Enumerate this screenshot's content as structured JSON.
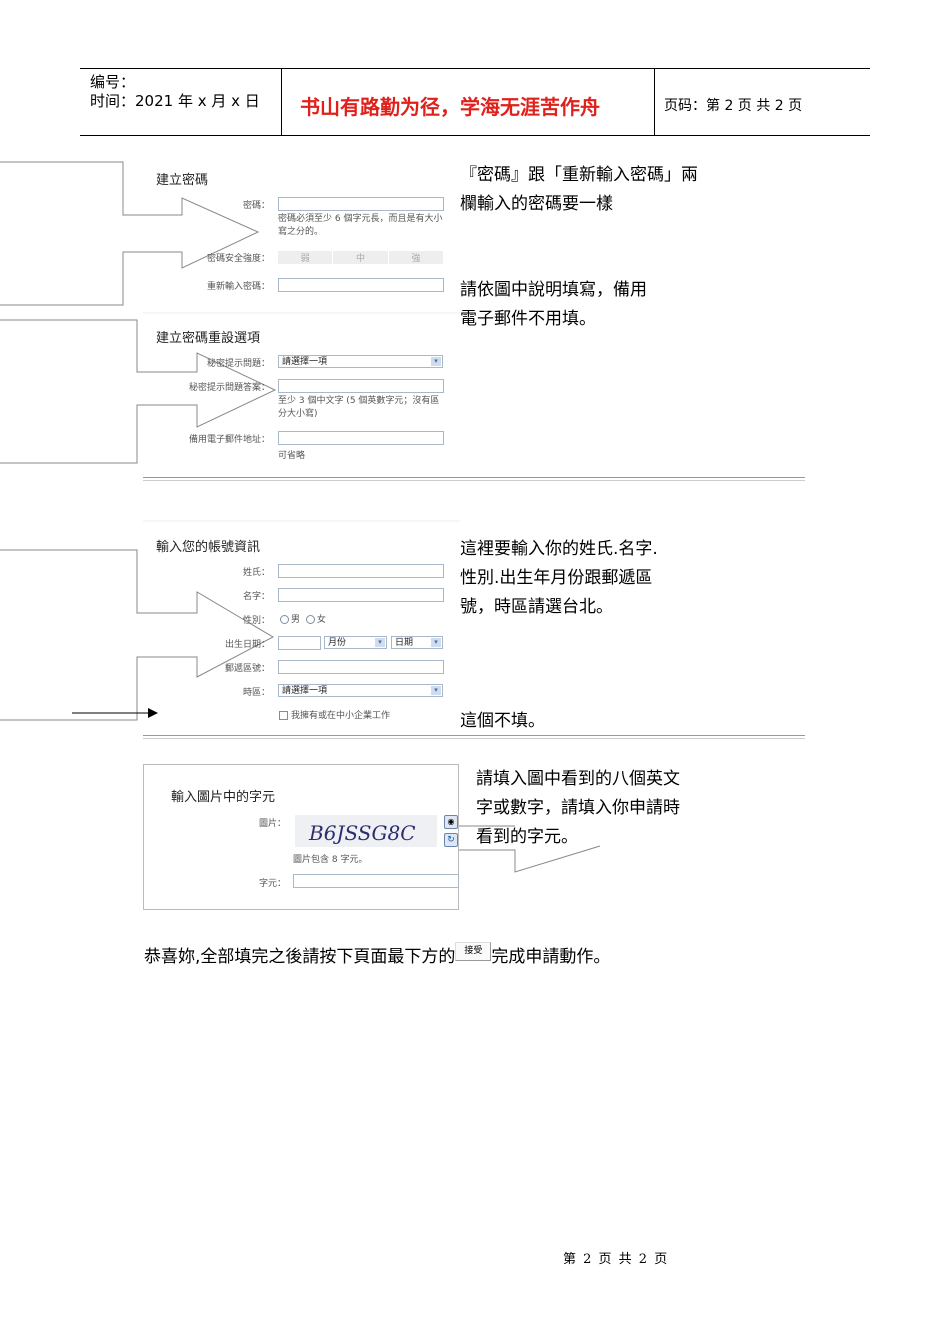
{
  "header": {
    "number_label": "编号：",
    "time_label": "时间：2021 年 x 月 x 日",
    "motto": "书山有路勤为径，学海无涯苦作舟",
    "page_label": "页码：第 2 页  共 2 页"
  },
  "section1": {
    "title": "建立密碼",
    "password_label": "密碼：",
    "password_hint": "密碼必須至少 6 個字元長，而且是有大小寫之分的。",
    "strength_label": "密碼安全強度：",
    "strength_levels": [
      "弱",
      "中",
      "強"
    ],
    "reenter_label": "重新輸入密碼：",
    "note": "『密碼』跟「重新輸入密碼」兩欄輸入的密碼要一樣"
  },
  "section2": {
    "title": "建立密碼重設選項",
    "question_label": "秘密提示問題：",
    "question_value": "請選擇一項",
    "answer_label": "秘密提示問題答案：",
    "answer_hint": "至少 3 個中文字 (5 個英數字元；沒有區分大小寫)",
    "email_label": "備用電子郵件地址：",
    "email_hint": "可省略",
    "note": "請依圖中說明填寫，備用電子郵件不用填。"
  },
  "section3": {
    "title": "輸入您的帳號資訊",
    "lastname_label": "姓氏：",
    "firstname_label": "名字：",
    "gender_label": "性別：",
    "gender_options": [
      "男",
      "女"
    ],
    "birth_label": "出生日期：",
    "month_value": "月份",
    "day_value": "日期",
    "zip_label": "郵遞區號：",
    "timezone_label": "時區：",
    "timezone_value": "請選擇一項",
    "business_label": "我擁有或在中小企業工作",
    "note": "這裡要輸入你的姓氏.名字.性別.出生年月份跟郵遞區號，時區請選台北。",
    "note2": "這個不填。"
  },
  "section4": {
    "title": "輸入圖片中的字元",
    "image_label": "圖片：",
    "captcha_text": "B6JSSG8C",
    "image_hint": "圖片包含 8 字元。",
    "chars_label": "字元：",
    "note": "請填入圖中看到的八個英文字或數字，請填入你申請時看到的字元。"
  },
  "footer_text": {
    "before": "恭喜妳,全部填完之後請按下頁面最下方的",
    "button": "接受",
    "after": "完成申請動作。"
  },
  "page_footer": "第 2 页 共 2 页"
}
